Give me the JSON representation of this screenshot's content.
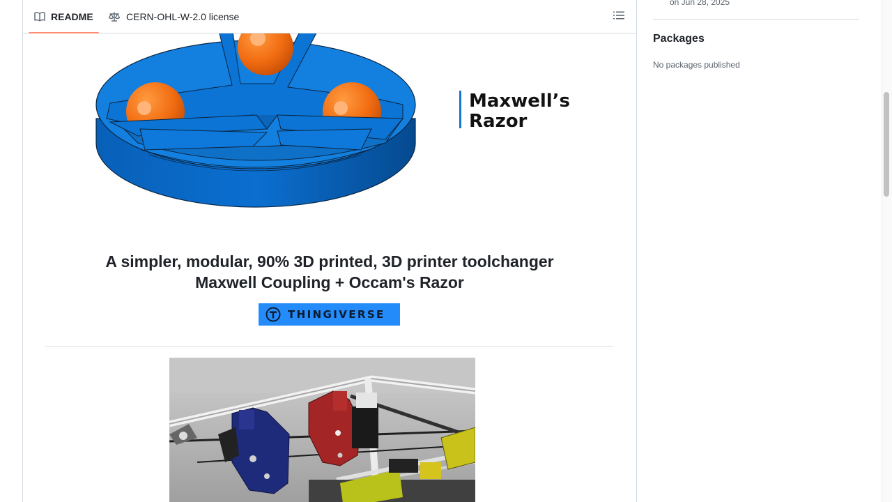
{
  "tabs": {
    "readme_label": "README",
    "license_label": "CERN-OHL-W-2.0 license"
  },
  "hero": {
    "logo_line1": "Maxwell’s",
    "logo_line2": "Razor",
    "accent_color": "#1976d2",
    "body_color": "#0a7ad8",
    "ball_color": "#f26d12"
  },
  "tagline": {
    "line1": "A simpler, modular, 90% 3D printed, 3D printer toolchanger",
    "line2": "Maxwell Coupling + Occam's Razor"
  },
  "thingiverse": {
    "label": "THINGIVERSE",
    "color": "#248bfb"
  },
  "sidebar": {
    "release_date": "on Jun 28, 2025",
    "packages_heading": "Packages",
    "packages_empty": "No packages published"
  },
  "icons": {
    "readme": "book-icon",
    "license": "scale-icon",
    "outline": "list-unordered-icon",
    "thingiverse": "thingiverse-logo-icon"
  },
  "colors": {
    "tab_underline": "#fd8c73",
    "border": "#d1d9e0"
  }
}
